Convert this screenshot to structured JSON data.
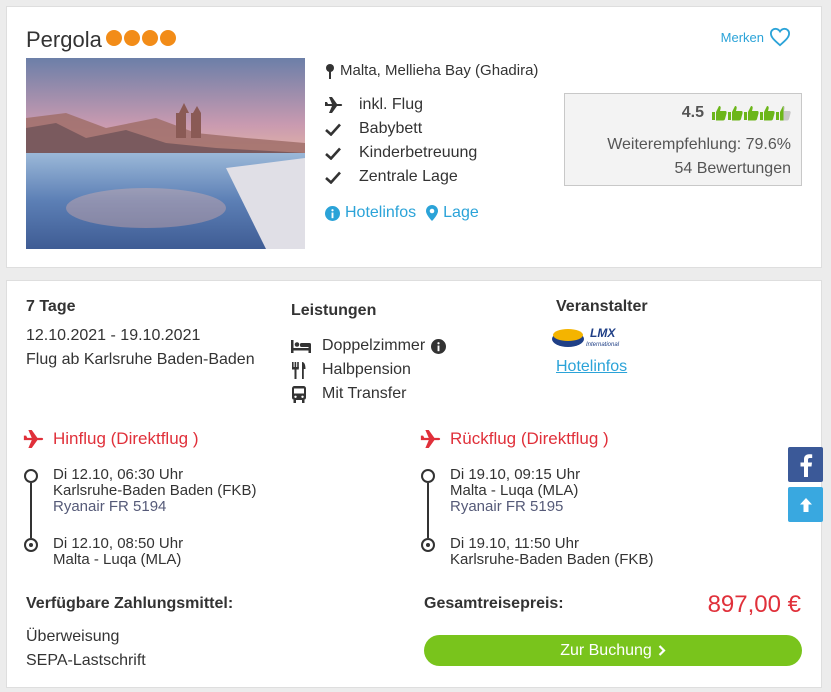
{
  "hotel": {
    "name": "Pergola",
    "stars": 4,
    "merken_label": "Merken",
    "location": "Malta, Mellieha Bay (Ghadira)",
    "features": [
      "inkl. Flug",
      "Babybett",
      "Kinderbetreuung",
      "Zentrale Lage"
    ],
    "link_hotelinfos": "Hotelinfos",
    "link_lage": "Lage"
  },
  "rating": {
    "score": "4.5",
    "thumbs": 4.5,
    "recommendation": "Weiterempfehlung: 79.6%",
    "reviews": "54 Bewertungen"
  },
  "offer": {
    "duration": "7 Tage",
    "dates": "12.10.2021 - 19.10.2021",
    "departure": "Flug ab Karlsruhe Baden-Baden",
    "services_title": "Leistungen",
    "services": [
      "Doppelzimmer",
      "Halbpension",
      "Mit Transfer"
    ],
    "operator_title": "Veranstalter",
    "operator_logo_text": "LMX",
    "operator_logo_sub": "International",
    "operator_link": "Hotelinfos"
  },
  "outbound": {
    "title": "Hinflug (Direktflug )",
    "dep_time": "Di 12.10, 06:30 Uhr",
    "dep_airport": "Karlsruhe-Baden Baden (FKB)",
    "carrier": "Ryanair FR 5194",
    "arr_time": "Di 12.10, 08:50 Uhr",
    "arr_airport": "Malta - Luqa (MLA)"
  },
  "return": {
    "title": "Rückflug (Direktflug )",
    "dep_time": "Di 19.10, 09:15 Uhr",
    "dep_airport": "Malta - Luqa (MLA)",
    "carrier": "Ryanair FR 5195",
    "arr_time": "Di 19.10, 11:50 Uhr",
    "arr_airport": "Karlsruhe-Baden Baden (FKB)"
  },
  "payment": {
    "title": "Verfügbare Zahlungsmittel:",
    "methods": [
      "Überweisung",
      "SEPA-Lastschrift"
    ]
  },
  "total": {
    "label": "Gesamtreisepreis:",
    "price": "897,00 €",
    "book_label": "Zur Buchung"
  },
  "colors": {
    "accent_blue": "#2ba3d8",
    "star_orange": "#f28c18",
    "flight_red": "#e0303a",
    "book_green": "#79c41c",
    "thumb_green": "#6cb61a",
    "facebook_blue": "#3b5998"
  },
  "icons": {
    "merken": "heart-outline-icon",
    "location": "map-pin-icon",
    "flight": "airplane-icon",
    "check": "checkmark-icon",
    "info": "info-circle-icon",
    "bed": "bed-icon",
    "meal": "fork-knife-icon",
    "transfer": "bus-icon",
    "facebook": "facebook-icon",
    "scroll_up": "arrow-up-icon"
  }
}
